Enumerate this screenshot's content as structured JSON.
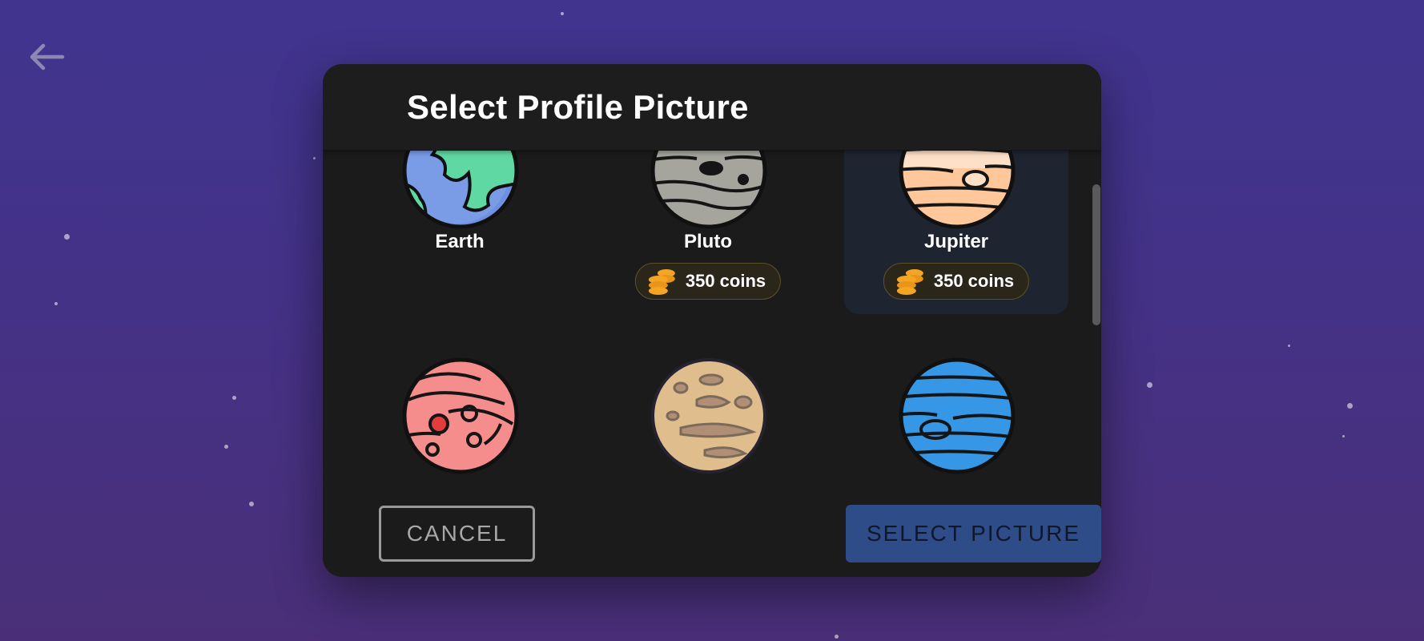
{
  "navigation": {
    "back_icon": "arrow-left-icon"
  },
  "dialog": {
    "title": "Select Profile Picture",
    "cancel_label": "CANCEL",
    "select_label": "SELECT PICTURE"
  },
  "pictures": [
    {
      "name": "Earth",
      "price": "",
      "icon": "earth-planet-icon",
      "selected": false
    },
    {
      "name": "Pluto",
      "price": "350 coins",
      "icon": "pluto-planet-icon",
      "selected": false
    },
    {
      "name": "Jupiter",
      "price": "350 coins",
      "icon": "jupiter-planet-icon",
      "selected": true
    },
    {
      "name": "",
      "price": "",
      "icon": "mars-planet-icon",
      "selected": false
    },
    {
      "name": "",
      "price": "",
      "icon": "venus-planet-icon",
      "selected": false
    },
    {
      "name": "",
      "price": "",
      "icon": "neptune-planet-icon",
      "selected": false
    }
  ],
  "colors": {
    "dialog_bg": "#1b1b1b",
    "selected_tile": "#1f2431",
    "primary_button": "#2e4c88",
    "coin": "#f5a524"
  }
}
